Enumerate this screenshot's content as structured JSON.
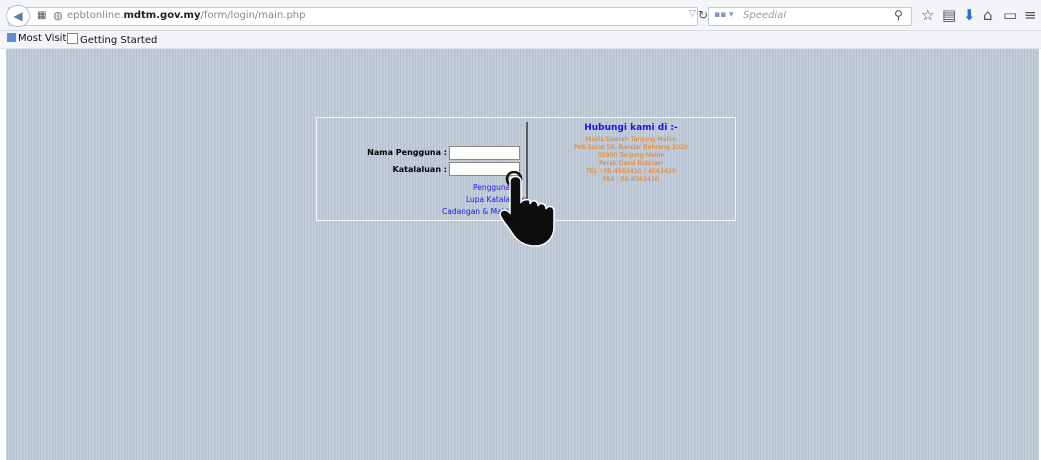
{
  "browser": {
    "url_prefix": "epbtonline.",
    "url_domain": "mdtm.gov.my",
    "url_path": "/form/login/main.php",
    "search_placeholder": "Speedial",
    "search_engine_label": "▪▪ ▾"
  },
  "bookmarks": [
    {
      "label": "Most Visited"
    },
    {
      "label": "Getting Started"
    }
  ],
  "login": {
    "username_label": "Nama Pengguna :",
    "password_label": "Katalaluan :",
    "username_value": "",
    "password_value": "",
    "links": [
      "Pengguna",
      "Lupa Katalaluan",
      "Cadangan & Maklum"
    ]
  },
  "contact": {
    "title": "Hubungi kami di :-",
    "lines": [
      "Majlis Daerah Tanjung Malim",
      "Peti Surat 59, Bandar Behrang 2020",
      "35900 Tanjung Malim",
      "Perak Darul Ridzuan",
      "TEL : 05-4563410 / 4563420",
      "FAX : 05-4563430"
    ]
  },
  "colors": {
    "link": "#1a1af0",
    "contact_title": "#1515e8",
    "contact_text": "#e27b1e",
    "page_background": "#bcc8d6"
  },
  "icons": {
    "back": "back-arrow-icon",
    "reload": "reload-icon",
    "search": "magnifier-icon",
    "cursor": "hand-pointer-icon"
  }
}
